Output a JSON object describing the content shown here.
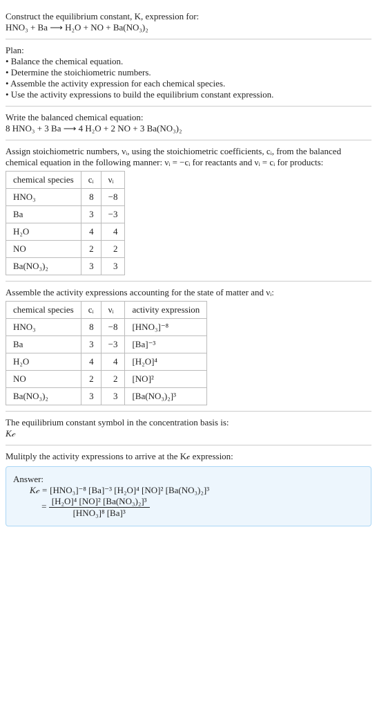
{
  "intro": {
    "line1": "Construct the equilibrium constant, K, expression for:",
    "equation": "HNO₃ + Ba ⟶ H₂O + NO + Ba(NO₃)₂"
  },
  "plan": {
    "heading": "Plan:",
    "items": [
      "• Balance the chemical equation.",
      "• Determine the stoichiometric numbers.",
      "• Assemble the activity expression for each chemical species.",
      "• Use the activity expressions to build the equilibrium constant expression."
    ]
  },
  "balanced": {
    "heading": "Write the balanced chemical equation:",
    "equation": "8 HNO₃ + 3 Ba ⟶ 4 H₂O + 2 NO + 3 Ba(NO₃)₂"
  },
  "stoich": {
    "text1": "Assign stoichiometric numbers, νᵢ, using the stoichiometric coefficients, cᵢ, from the balanced chemical equation in the following manner: νᵢ = −cᵢ for reactants and νᵢ = cᵢ for products:",
    "headers": [
      "chemical species",
      "cᵢ",
      "νᵢ"
    ],
    "rows": [
      [
        "HNO₃",
        "8",
        "−8"
      ],
      [
        "Ba",
        "3",
        "−3"
      ],
      [
        "H₂O",
        "4",
        "4"
      ],
      [
        "NO",
        "2",
        "2"
      ],
      [
        "Ba(NO₃)₂",
        "3",
        "3"
      ]
    ]
  },
  "activity": {
    "text1": "Assemble the activity expressions accounting for the state of matter and νᵢ:",
    "headers": [
      "chemical species",
      "cᵢ",
      "νᵢ",
      "activity expression"
    ],
    "rows": [
      [
        "HNO₃",
        "8",
        "−8",
        "[HNO₃]⁻⁸"
      ],
      [
        "Ba",
        "3",
        "−3",
        "[Ba]⁻³"
      ],
      [
        "H₂O",
        "4",
        "4",
        "[H₂O]⁴"
      ],
      [
        "NO",
        "2",
        "2",
        "[NO]²"
      ],
      [
        "Ba(NO₃)₂",
        "3",
        "3",
        "[Ba(NO₃)₂]³"
      ]
    ]
  },
  "symbol": {
    "text1": "The equilibrium constant symbol in the concentration basis is:",
    "symbol": "K𝒸"
  },
  "multiply": {
    "text1": "Mulitply the activity expressions to arrive at the K𝒸 expression:"
  },
  "answer": {
    "heading": "Answer:",
    "line1_pre": "K𝒸 = ",
    "line1_expr": "[HNO₃]⁻⁸ [Ba]⁻³ [H₂O]⁴ [NO]² [Ba(NO₃)₂]³",
    "frac_num": "[H₂O]⁴ [NO]² [Ba(NO₃)₂]³",
    "frac_den": "[HNO₃]⁸ [Ba]³",
    "equals": " = "
  }
}
